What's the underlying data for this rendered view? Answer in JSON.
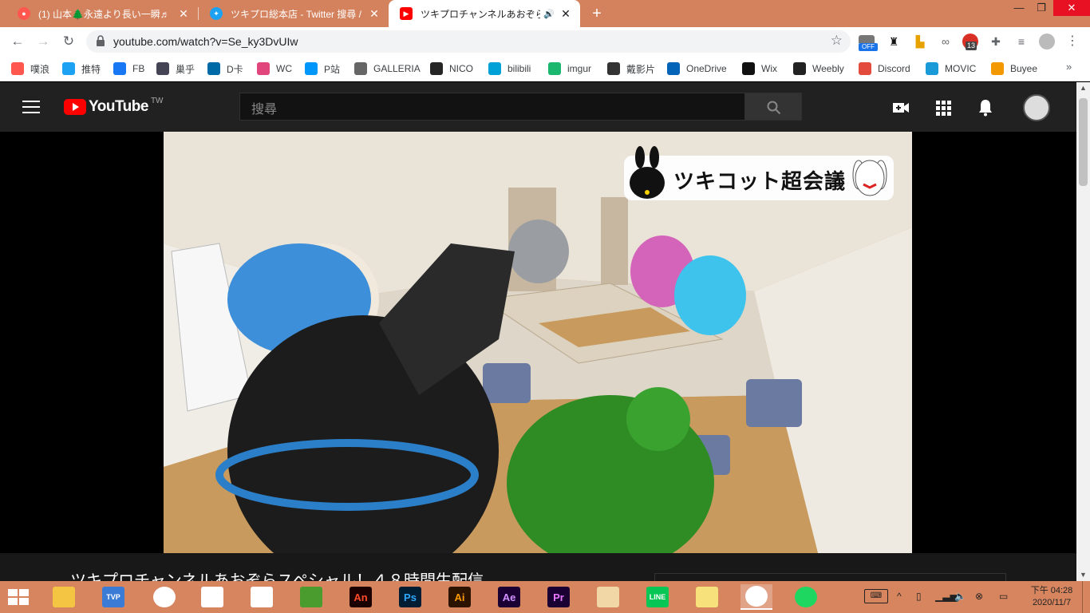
{
  "browser": {
    "tabs": [
      {
        "title": "(1) 山本🌲永遠より長い一瞬♬",
        "favicon": "weibo-icon"
      },
      {
        "title": "ツキプロ総本店 - Twitter 搜尋 /",
        "favicon": "twitter-icon"
      },
      {
        "title": "ツキプロチャンネルあおぞら",
        "favicon": "youtube-icon",
        "active": true
      }
    ],
    "new_tab_label": "+",
    "url": "youtube.com/watch?v=Se_ky3DvUIw",
    "extension_badge_off": "OFF",
    "extension_badge_count": "13"
  },
  "bookmarks": [
    {
      "label": "噗浪",
      "icon": "plurk-icon",
      "color": "#ff574d"
    },
    {
      "label": "推特",
      "icon": "twitter-icon",
      "color": "#1da1f2"
    },
    {
      "label": "FB",
      "icon": "facebook-icon",
      "color": "#1877f2"
    },
    {
      "label": "巢乎",
      "icon": "avatar-icon",
      "color": "#445"
    },
    {
      "label": "D卡",
      "icon": "dcard-icon",
      "color": "#006aa6"
    },
    {
      "label": "WC",
      "icon": "wc-icon",
      "color": "#e0457b"
    },
    {
      "label": "P站",
      "icon": "pixiv-icon",
      "color": "#0096fa"
    },
    {
      "label": "GALLERIA",
      "icon": "galleria-icon",
      "color": "#666"
    },
    {
      "label": "NICO",
      "icon": "nico-icon",
      "color": "#252525"
    },
    {
      "label": "bilibili",
      "icon": "bilibili-icon",
      "color": "#00a1d6"
    },
    {
      "label": "imgur",
      "icon": "imgur-icon",
      "color": "#1bb76e"
    },
    {
      "label": "戴影片",
      "icon": "download-icon",
      "color": "#333"
    },
    {
      "label": "OneDrive",
      "icon": "onedrive-icon",
      "color": "#0364b8"
    },
    {
      "label": "Wix",
      "icon": "wix-icon",
      "color": "#111"
    },
    {
      "label": "Weebly",
      "icon": "weebly-icon",
      "color": "#222"
    },
    {
      "label": "Discord",
      "icon": "discord-icon",
      "color": "#e34c3c"
    },
    {
      "label": "MOVIC",
      "icon": "movic-icon",
      "color": "#1a9ad6"
    },
    {
      "label": "Buyee",
      "icon": "buyee-icon",
      "color": "#f39800"
    }
  ],
  "youtube": {
    "logo_word": "YouTube",
    "country": "TW",
    "search_placeholder": "搜尋",
    "video_overlay_text": "ツキコット超会議",
    "video_title": "ツキプロチャンネルあおぞらスペシャル！４８時間生配信"
  },
  "taskbar": {
    "apps": [
      {
        "name": "file-explorer",
        "label": ""
      },
      {
        "name": "tvp",
        "label": "TVP"
      },
      {
        "name": "chrome",
        "label": ""
      },
      {
        "name": "clip-studio-1",
        "label": ""
      },
      {
        "name": "clip-studio-2",
        "label": ""
      },
      {
        "name": "tennis-app",
        "label": ""
      },
      {
        "name": "animate",
        "label": "An"
      },
      {
        "name": "photoshop",
        "label": "Ps"
      },
      {
        "name": "illustrator",
        "label": "Ai"
      },
      {
        "name": "after-effects",
        "label": "Ae"
      },
      {
        "name": "premiere",
        "label": "Pr"
      },
      {
        "name": "paint",
        "label": ""
      },
      {
        "name": "line",
        "label": "LINE"
      },
      {
        "name": "sticky",
        "label": ""
      },
      {
        "name": "chrome-active",
        "label": ""
      },
      {
        "name": "spotify",
        "label": ""
      }
    ],
    "clock_time": "下午 04:28",
    "clock_date": "2020/11/7"
  }
}
